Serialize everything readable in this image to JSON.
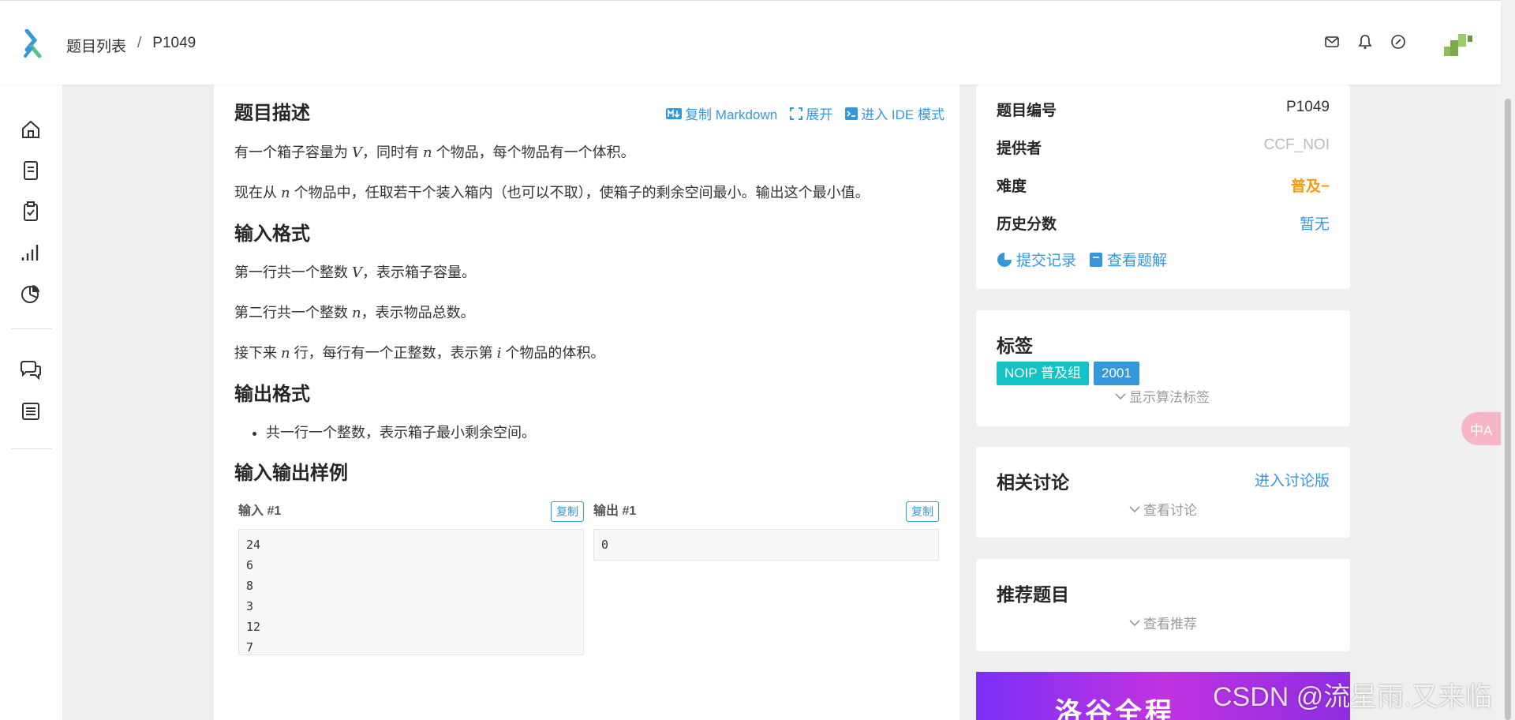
{
  "breadcrumb": {
    "list": "题目列表",
    "separator": "/",
    "current": "P1049"
  },
  "problem": {
    "title": "题目描述",
    "actions": {
      "copy_markdown": "复制 Markdown",
      "expand": "展开",
      "ide_mode": "进入 IDE 模式"
    },
    "description_1_pre": "有一个箱子容量为",
    "description_1_var1": "V",
    "description_1_mid": "，同时有",
    "description_1_var2": "n",
    "description_1_post": "个物品，每个物品有一个体积。",
    "description_2_pre": "现在从",
    "description_2_var": "n",
    "description_2_post": "个物品中，任取若干个装入箱内（也可以不取），使箱子的剩余空间最小。输出这个最小值。",
    "input_title": "输入格式",
    "input_1_pre": "第一行共一个整数",
    "input_1_var": "V",
    "input_1_post": "，表示箱子容量。",
    "input_2_pre": "第二行共一个整数",
    "input_2_var": "n",
    "input_2_post": "，表示物品总数。",
    "input_3_pre": "接下来",
    "input_3_var1": "n",
    "input_3_mid": "行，每行有一个正整数，表示第",
    "input_3_var2": "i",
    "input_3_post": "个物品的体积。",
    "output_title": "输出格式",
    "output_item": "共一行一个整数，表示箱子最小剩余空间。",
    "samples_title": "输入输出样例",
    "sample_input_label": "输入 #1",
    "sample_output_label": "输出 #1",
    "copy_label": "复制",
    "sample_input": "24\n6\n8\n3\n12\n7",
    "sample_output": "0"
  },
  "info": {
    "id_label": "题目编号",
    "id_value": "P1049",
    "provider_label": "提供者",
    "provider_value": "CCF_NOI",
    "difficulty_label": "难度",
    "difficulty_value": "普及−",
    "history_label": "历史分数",
    "history_value": "暂无",
    "submissions_link": "提交记录",
    "solutions_link": "查看题解"
  },
  "tags": {
    "title": "标签",
    "items": [
      "NOIP 普及组",
      "2001"
    ],
    "show_algorithm": "显示算法标签"
  },
  "discussion": {
    "title": "相关讨论",
    "enter_link": "进入讨论版",
    "view": "查看讨论"
  },
  "recommend": {
    "title": "推荐题目",
    "view": "查看推荐"
  },
  "ad": {
    "text": "洛谷全程"
  },
  "float_badge": {
    "text": "中A"
  },
  "watermark": "CSDN @流星雨.又来临",
  "colors": {
    "accent": "#3498db",
    "difficulty": "#f39c11",
    "tag_noip": "#13c2c2",
    "tag_year": "#3498db",
    "provider": "#bbbbbb"
  }
}
